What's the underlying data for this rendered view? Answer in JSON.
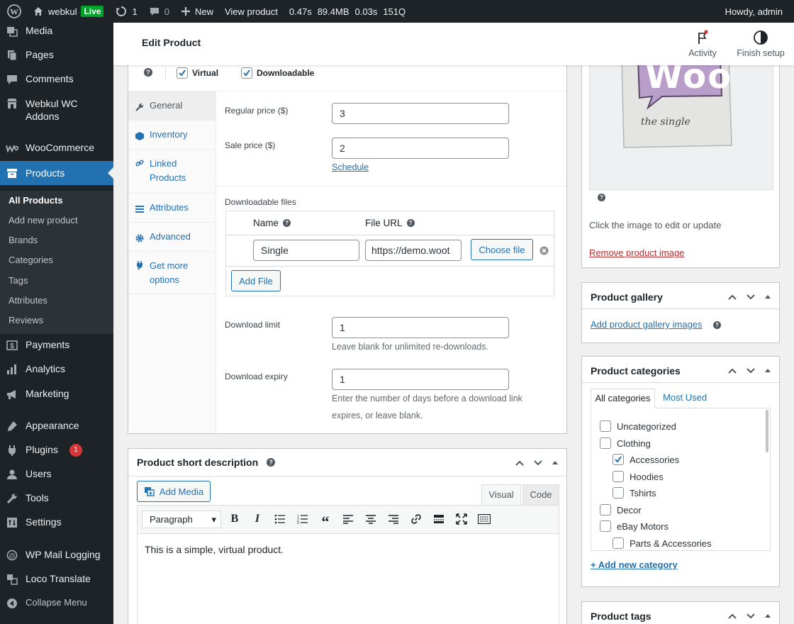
{
  "admin_bar": {
    "site_name": "webkul",
    "live_badge": "Live",
    "updates_count": "1",
    "comments_count": "0",
    "new_label": "New",
    "view_product_label": "View product",
    "perf_time": "0.47s",
    "perf_memory": "89.4MB",
    "perf_query_time": "0.03s",
    "perf_queries": "151Q",
    "howdy": "Howdy, admin"
  },
  "sidebar": {
    "items": [
      {
        "label": "Media",
        "icon": "media-icon"
      },
      {
        "label": "Pages",
        "icon": "pages-icon"
      },
      {
        "label": "Comments",
        "icon": "comments-icon"
      },
      {
        "label": "Webkul WC Addons",
        "icon": "store-icon"
      },
      {
        "label": "WooCommerce",
        "icon": "woocommerce-icon"
      },
      {
        "label": "Products",
        "icon": "products-icon"
      },
      {
        "label": "Payments",
        "icon": "payments-icon"
      },
      {
        "label": "Analytics",
        "icon": "analytics-icon"
      },
      {
        "label": "Marketing",
        "icon": "marketing-icon"
      },
      {
        "label": "Appearance",
        "icon": "appearance-icon"
      },
      {
        "label": "Plugins",
        "icon": "plugins-icon",
        "badge": "1"
      },
      {
        "label": "Users",
        "icon": "users-icon"
      },
      {
        "label": "Tools",
        "icon": "tools-icon"
      },
      {
        "label": "Settings",
        "icon": "settings-icon"
      },
      {
        "label": "WP Mail Logging",
        "icon": "mail-logging-icon"
      },
      {
        "label": "Loco Translate",
        "icon": "translate-icon"
      },
      {
        "label": "Collapse Menu",
        "icon": "collapse-icon"
      }
    ],
    "submenu": [
      "All Products",
      "Add new product",
      "Brands",
      "Categories",
      "Tags",
      "Attributes",
      "Reviews"
    ]
  },
  "header": {
    "title": "Edit Product",
    "activity_label": "Activity",
    "finish_setup_label": "Finish setup"
  },
  "product_data": {
    "virtual_label": "Virtual",
    "downloadable_label": "Downloadable",
    "tabs": [
      "General",
      "Inventory",
      "Linked Products",
      "Attributes",
      "Advanced",
      "Get more options"
    ],
    "regular_price_label": "Regular price ($)",
    "regular_price_value": "3",
    "sale_price_label": "Sale price ($)",
    "sale_price_value": "2",
    "schedule_link": "Schedule",
    "downloadable_files_label": "Downloadable files",
    "name_col": "Name",
    "file_url_col": "File URL",
    "file_name_value": "Single",
    "file_url_value": "https://demo.woot",
    "choose_file_label": "Choose file",
    "add_file_label": "Add File",
    "download_limit_label": "Download limit",
    "download_limit_value": "1",
    "download_limit_desc": "Leave blank for unlimited re-downloads.",
    "download_expiry_label": "Download expiry",
    "download_expiry_value": "1",
    "download_expiry_desc": "Enter the number of days before a download link expires, or leave blank."
  },
  "short_description": {
    "title": "Product short description",
    "add_media_label": "Add Media",
    "visual_tab": "Visual",
    "code_tab": "Code",
    "format_select": "Paragraph",
    "content": "This is a simple, virtual product."
  },
  "product_image": {
    "woo_text": "Woo",
    "caption": "the single",
    "edit_hint": "Click the image to edit or update",
    "remove_link": "Remove product image"
  },
  "product_gallery": {
    "title": "Product gallery",
    "add_link": "Add product gallery images"
  },
  "product_categories": {
    "title": "Product categories",
    "tab_all": "All categories",
    "tab_most_used": "Most Used",
    "items": [
      {
        "label": "Uncategorized",
        "checked": false,
        "level": 0
      },
      {
        "label": "Clothing",
        "checked": false,
        "level": 0
      },
      {
        "label": "Accessories",
        "checked": true,
        "level": 1
      },
      {
        "label": "Hoodies",
        "checked": false,
        "level": 1
      },
      {
        "label": "Tshirts",
        "checked": false,
        "level": 1
      },
      {
        "label": "Decor",
        "checked": false,
        "level": 0
      },
      {
        "label": "eBay Motors",
        "checked": false,
        "level": 0
      },
      {
        "label": "Parts & Accessories",
        "checked": false,
        "level": 1
      }
    ],
    "add_new_link": "+ Add new category"
  },
  "product_tags": {
    "title": "Product tags"
  },
  "colors": {
    "accent": "#2271b1",
    "admin_dark": "#1d2327",
    "live_green": "#00a32a",
    "badge_red": "#d63638",
    "remove_red": "#b32d2e"
  }
}
